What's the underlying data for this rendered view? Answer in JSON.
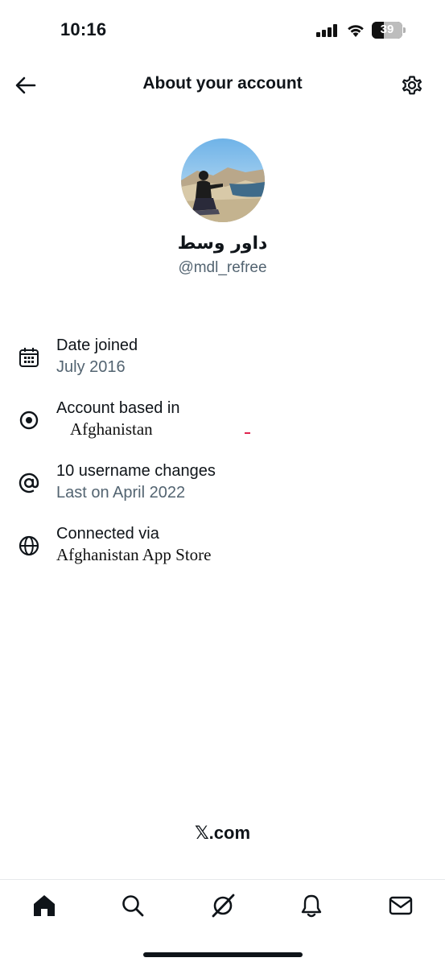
{
  "status_bar": {
    "time": "10:16",
    "battery_level": "39",
    "battery_percent": 39
  },
  "header": {
    "title": "About your account",
    "back_icon": "arrow-left-icon",
    "settings_icon": "gear-icon"
  },
  "profile": {
    "display_name": "داور وسط",
    "handle": "@mdl_refree"
  },
  "info_rows": [
    {
      "icon": "calendar-icon",
      "title": "Date joined",
      "subtitle": "July 2016"
    },
    {
      "icon": "location-pin-icon",
      "title": "Account based in",
      "subtitle": "Afghanistan"
    },
    {
      "icon": "at-sign-icon",
      "title": "10 username changes",
      "subtitle": "Last on April 2022"
    },
    {
      "icon": "globe-icon",
      "title": "Connected via",
      "subtitle": "Afghanistan App Store"
    }
  ],
  "footer": {
    "logo_text": "𝕏.com"
  },
  "tab_bar": {
    "items": [
      "home-icon",
      "search-icon",
      "grok-icon",
      "notifications-bell-icon",
      "messages-envelope-icon"
    ]
  },
  "colors": {
    "text_primary": "#0f1419",
    "text_secondary": "#536471",
    "accent_red": "#e0244f"
  }
}
